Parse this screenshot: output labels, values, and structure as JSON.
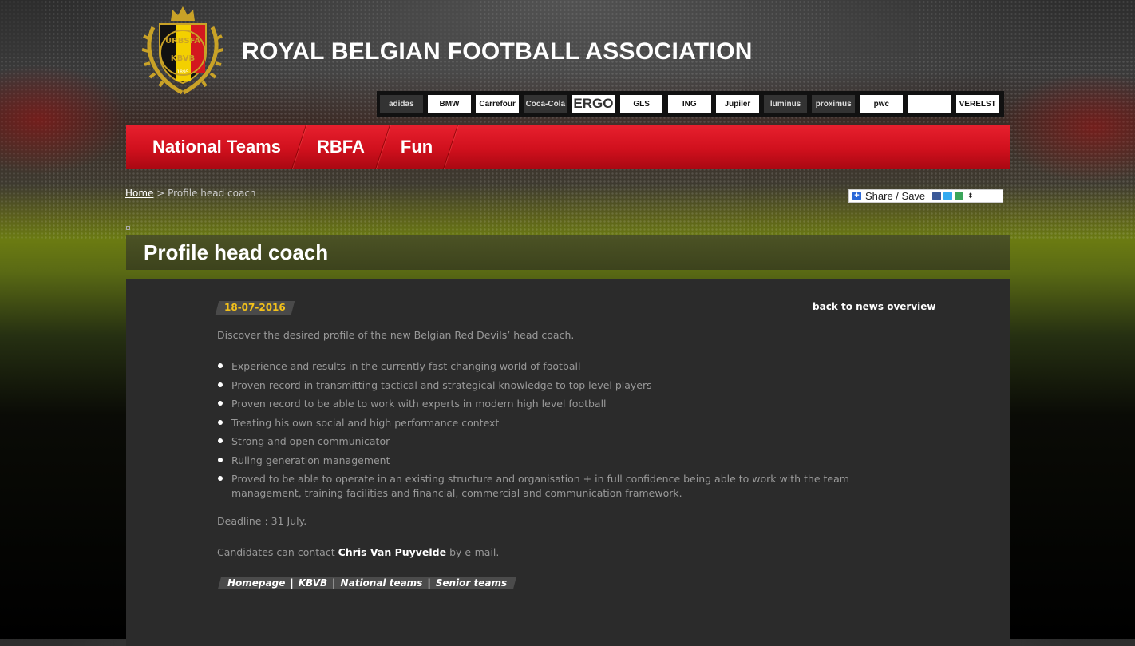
{
  "header": {
    "site_title": "ROYAL BELGIAN FOOTBALL ASSOCIATION",
    "crest_text_top": "URBSFA",
    "crest_text_bottom": "KBVB",
    "crest_year": "1895"
  },
  "sponsors": [
    {
      "name": "adidas",
      "label": "adidas",
      "style": "dark"
    },
    {
      "name": "bmw",
      "label": "BMW",
      "style": "light"
    },
    {
      "name": "carrefour",
      "label": "Carrefour",
      "style": "light"
    },
    {
      "name": "coca-cola",
      "label": "Coca-Cola",
      "style": "dark"
    },
    {
      "name": "ergo",
      "label": "ERGO",
      "style": "light"
    },
    {
      "name": "gls",
      "label": "GLS",
      "style": "light"
    },
    {
      "name": "ing",
      "label": "ING",
      "style": "light"
    },
    {
      "name": "jupiler",
      "label": "Jupiler",
      "style": "light"
    },
    {
      "name": "luminus",
      "label": "luminus",
      "style": "dark"
    },
    {
      "name": "proximus",
      "label": "proximus",
      "style": "dark"
    },
    {
      "name": "pwc",
      "label": "pwc",
      "style": "light"
    },
    {
      "name": "sponsor-12",
      "label": "",
      "style": "light"
    },
    {
      "name": "verelst",
      "label": "VERELST",
      "style": "light"
    }
  ],
  "nav": {
    "items": [
      {
        "label": "National Teams"
      },
      {
        "label": "RBFA"
      },
      {
        "label": "Fun"
      }
    ]
  },
  "breadcrumb": {
    "home": "Home",
    "separator": " > ",
    "current": "Profile head coach"
  },
  "share": {
    "label": "Share / Save"
  },
  "page": {
    "title": "Profile head coach"
  },
  "article": {
    "date": "18-07-2016",
    "back_link": "back to news overview",
    "intro": "Discover the desired profile of the new Belgian Red Devils’ head coach.",
    "bullets": [
      "Experience and results in the currently fast changing world of football",
      "Proven record in transmitting tactical and strategical knowledge to top level players",
      "Proven record to be able to work with experts in modern high level football",
      "Treating his own social and high performance context",
      "Strong and open communicator",
      "Ruling generation management",
      "Proved to be able to operate in an existing structure and organisation + in full confidence being able to work with the team management, training facilities and financial, commercial and communication framework."
    ],
    "deadline": "Deadline : 31 July.",
    "contact_prefix": "Candidates can contact ",
    "contact_name": "Chris Van Puyvelde",
    "contact_suffix": " by e-mail.",
    "tags": [
      "Homepage",
      "KBVB",
      "National teams",
      "Senior teams"
    ],
    "tag_separator": "|"
  },
  "colors": {
    "nav_red": "#d0101d",
    "date_yellow": "#f4c21a",
    "content_bg": "#2b2b2b"
  }
}
